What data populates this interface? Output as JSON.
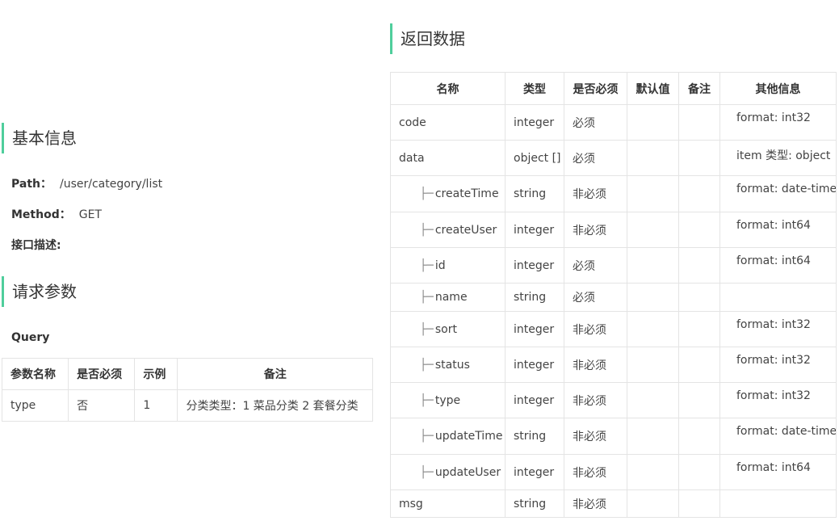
{
  "basic": {
    "title": "基本信息",
    "path_label": "Path：",
    "path_value": "/user/category/list",
    "method_label": "Method：",
    "method_value": "GET",
    "desc_label": "接口描述:"
  },
  "request": {
    "title": "请求参数",
    "query_label": "Query",
    "headers": [
      "参数名称",
      "是否必须",
      "示例",
      "备注"
    ],
    "rows": [
      {
        "name": "type",
        "required": "否",
        "example": "1",
        "remark": "分类类型：1 菜品分类 2 套餐分类"
      }
    ]
  },
  "response": {
    "title": "返回数据",
    "headers": [
      "名称",
      "类型",
      "是否必须",
      "默认值",
      "备注",
      "其他信息"
    ],
    "tree_glyph": "├─",
    "rows": [
      {
        "name": "code",
        "type": "integer",
        "required": "必须",
        "default": "",
        "remark": "",
        "other": "format: int32"
      },
      {
        "name": "data",
        "type": "object []",
        "required": "必须",
        "default": "",
        "remark": "",
        "other": "item 类型: object"
      },
      {
        "name": "createTime",
        "type": "string",
        "required": "非必须",
        "default": "",
        "remark": "",
        "other": "format: date-time"
      },
      {
        "name": "createUser",
        "type": "integer",
        "required": "非必须",
        "default": "",
        "remark": "",
        "other": "format: int64"
      },
      {
        "name": "id",
        "type": "integer",
        "required": "必须",
        "default": "",
        "remark": "",
        "other": "format: int64"
      },
      {
        "name": "name",
        "type": "string",
        "required": "必须",
        "default": "",
        "remark": "",
        "other": ""
      },
      {
        "name": "sort",
        "type": "integer",
        "required": "非必须",
        "default": "",
        "remark": "",
        "other": "format: int32"
      },
      {
        "name": "status",
        "type": "integer",
        "required": "非必须",
        "default": "",
        "remark": "",
        "other": "format: int32"
      },
      {
        "name": "type",
        "type": "integer",
        "required": "非必须",
        "default": "",
        "remark": "",
        "other": "format: int32"
      },
      {
        "name": "updateTime",
        "type": "string",
        "required": "非必须",
        "default": "",
        "remark": "",
        "other": "format: date-time"
      },
      {
        "name": "updateUser",
        "type": "integer",
        "required": "非必须",
        "default": "",
        "remark": "",
        "other": "format: int64"
      },
      {
        "name": "msg",
        "type": "string",
        "required": "非必须",
        "default": "",
        "remark": "",
        "other": ""
      }
    ]
  },
  "colors": {
    "accent": "#4fce9c",
    "border": "#e4e4e4",
    "text": "#333333"
  }
}
